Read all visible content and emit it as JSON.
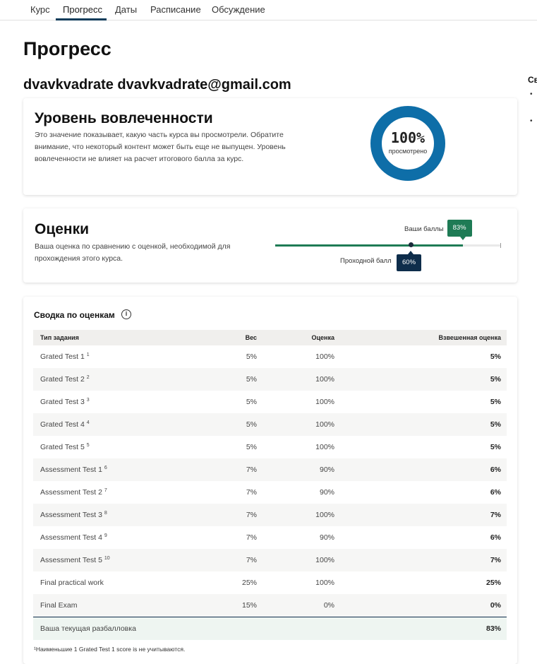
{
  "tabs": [
    {
      "label": "Курс"
    },
    {
      "label": "Прогресс"
    },
    {
      "label": "Даты"
    },
    {
      "label": "Расписание"
    },
    {
      "label": "Обсуждение"
    }
  ],
  "active_tab": "Прогресс",
  "page_title": "Прогресс",
  "user": "dvavkvadrate dvavkvadrate@gmail.com",
  "sidebar_peek": {
    "title": "Св",
    "bullets": [
      "•",
      "•"
    ]
  },
  "engagement": {
    "title": "Уровень вовлеченности",
    "description": "Это значение показывает, какую часть курса вы просмотрели. Обратите внимание, что некоторый контент может быть еще не выпущен. Уровень вовлеченности не влияет на расчет итогового балла за курс.",
    "percent_label": "100%",
    "percent_value": 100,
    "sub_label": "просмотрено",
    "ring_color": "#0e6ea8"
  },
  "grades": {
    "title": "Оценки",
    "description": "Ваша оценка по сравнению с оценкой, необходимой для прохождения этого курса.",
    "your_score_caption": "Ваши баллы",
    "your_score_label": "83%",
    "your_score_value": 83,
    "passing_caption": "Проходной балл",
    "passing_label": "60%",
    "passing_value": 60,
    "accent_color": "#1e7b55",
    "passing_color": "#0e2d4b"
  },
  "summary": {
    "title": "Сводка по оценкам",
    "info_icon": "info-icon",
    "columns": [
      "Тип задания",
      "Вес",
      "Оценка",
      "Взвешенная оценка"
    ],
    "rows": [
      {
        "name": "Grated Test 1",
        "sup": "1",
        "weight": "5%",
        "score": "100%",
        "weighted": "5%"
      },
      {
        "name": "Grated Test 2",
        "sup": "2",
        "weight": "5%",
        "score": "100%",
        "weighted": "5%"
      },
      {
        "name": "Grated Test 3",
        "sup": "3",
        "weight": "5%",
        "score": "100%",
        "weighted": "5%"
      },
      {
        "name": "Grated Test 4",
        "sup": "4",
        "weight": "5%",
        "score": "100%",
        "weighted": "5%"
      },
      {
        "name": "Grated Test 5",
        "sup": "5",
        "weight": "5%",
        "score": "100%",
        "weighted": "5%"
      },
      {
        "name": "Assessment Test 1",
        "sup": "6",
        "weight": "7%",
        "score": "90%",
        "weighted": "6%"
      },
      {
        "name": "Assessment Test 2",
        "sup": "7",
        "weight": "7%",
        "score": "90%",
        "weighted": "6%"
      },
      {
        "name": "Assessment Test 3",
        "sup": "8",
        "weight": "7%",
        "score": "100%",
        "weighted": "7%"
      },
      {
        "name": "Assessment Test 4",
        "sup": "9",
        "weight": "7%",
        "score": "90%",
        "weighted": "6%"
      },
      {
        "name": "Assessment Test 5",
        "sup": "10",
        "weight": "7%",
        "score": "100%",
        "weighted": "7%"
      },
      {
        "name": "Final practical work",
        "sup": "",
        "weight": "25%",
        "score": "100%",
        "weighted": "25%"
      },
      {
        "name": "Final Exam",
        "sup": "",
        "weight": "15%",
        "score": "0%",
        "weighted": "0%"
      }
    ],
    "total_label": "Ваша текущая разбалловка",
    "total_value": "83%",
    "footnote": "¹Наименьшие 1 Grated Test 1 score is не учитываются."
  }
}
